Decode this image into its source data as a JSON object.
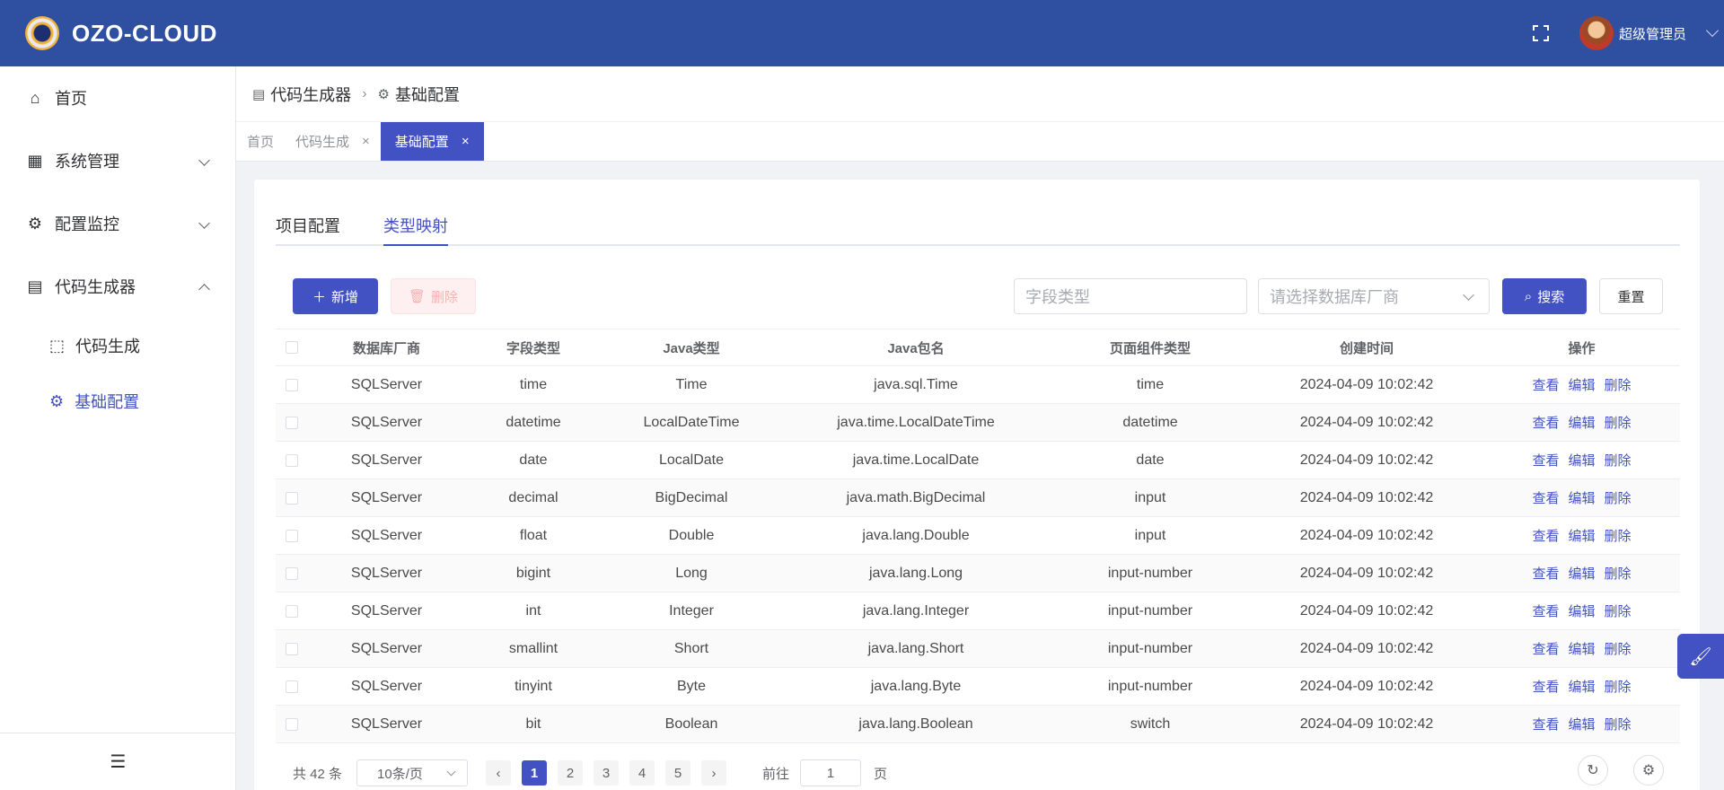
{
  "header": {
    "brand": "OZO-CLOUD",
    "user": "超级管理员",
    "colors": {
      "primary": "#2f4fa0",
      "accent": "#4352c2"
    }
  },
  "sidebar": {
    "items": [
      {
        "label": "首页",
        "icon": "home-icon"
      },
      {
        "label": "系统管理",
        "icon": "grid-icon"
      },
      {
        "label": "配置监控",
        "icon": "gear-icon"
      },
      {
        "label": "代码生成器",
        "icon": "code-generator-icon"
      }
    ],
    "sub_items": [
      {
        "label": "代码生成",
        "icon": "chip-icon"
      },
      {
        "label": "基础配置",
        "icon": "gear-icon"
      }
    ]
  },
  "breadcrumb": {
    "parent": "代码生成器",
    "current": "基础配置"
  },
  "tabs": [
    {
      "label": "首页"
    },
    {
      "label": "代码生成"
    },
    {
      "label": "基础配置"
    }
  ],
  "inner_tabs": [
    {
      "label": "项目配置"
    },
    {
      "label": "类型映射"
    }
  ],
  "toolbar": {
    "add_label": "新增",
    "delete_label": "删除",
    "field_type_placeholder": "字段类型",
    "db_vendor_placeholder": "请选择数据库厂商",
    "search_label": "搜索",
    "reset_label": "重置"
  },
  "table": {
    "columns": [
      "数据库厂商",
      "字段类型",
      "Java类型",
      "Java包名",
      "页面组件类型",
      "创建时间",
      "操作"
    ],
    "actions": [
      "查看",
      "编辑",
      "删除"
    ],
    "rows": [
      [
        "SQLServer",
        "time",
        "Time",
        "java.sql.Time",
        "time",
        "2024-04-09 10:02:42"
      ],
      [
        "SQLServer",
        "datetime",
        "LocalDateTime",
        "java.time.LocalDateTime",
        "datetime",
        "2024-04-09 10:02:42"
      ],
      [
        "SQLServer",
        "date",
        "LocalDate",
        "java.time.LocalDate",
        "date",
        "2024-04-09 10:02:42"
      ],
      [
        "SQLServer",
        "decimal",
        "BigDecimal",
        "java.math.BigDecimal",
        "input",
        "2024-04-09 10:02:42"
      ],
      [
        "SQLServer",
        "float",
        "Double",
        "java.lang.Double",
        "input",
        "2024-04-09 10:02:42"
      ],
      [
        "SQLServer",
        "bigint",
        "Long",
        "java.lang.Long",
        "input-number",
        "2024-04-09 10:02:42"
      ],
      [
        "SQLServer",
        "int",
        "Integer",
        "java.lang.Integer",
        "input-number",
        "2024-04-09 10:02:42"
      ],
      [
        "SQLServer",
        "smallint",
        "Short",
        "java.lang.Short",
        "input-number",
        "2024-04-09 10:02:42"
      ],
      [
        "SQLServer",
        "tinyint",
        "Byte",
        "java.lang.Byte",
        "input-number",
        "2024-04-09 10:02:42"
      ],
      [
        "SQLServer",
        "bit",
        "Boolean",
        "java.lang.Boolean",
        "switch",
        "2024-04-09 10:02:42"
      ]
    ]
  },
  "pagination": {
    "total": "共 42 条",
    "page_size": "10条/页",
    "pages": [
      "1",
      "2",
      "3",
      "4",
      "5"
    ],
    "current": "1",
    "goto_label": "前往",
    "goto_value": "1",
    "unit": "页",
    "prev": "‹",
    "next": "›"
  }
}
